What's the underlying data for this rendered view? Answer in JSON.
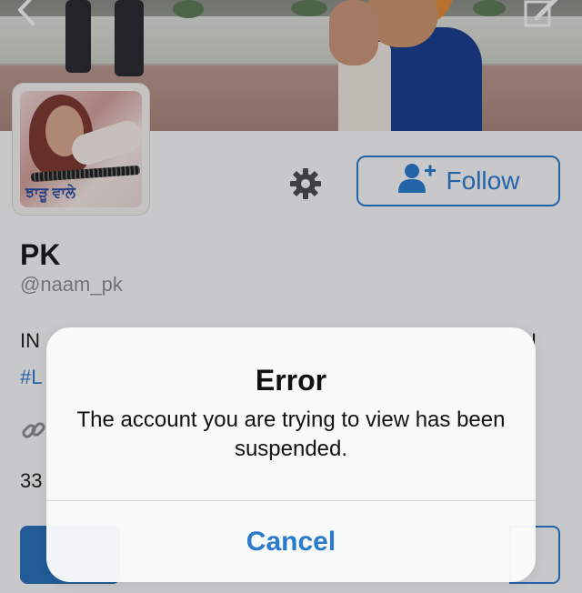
{
  "header": {
    "back_icon": "chevron-left-icon",
    "compose_icon": "compose-icon"
  },
  "profile": {
    "avatar_caption": "ਝਾੜੂ ਵਾਲੇ",
    "name": "PK",
    "handle": "@naam_pk",
    "bio_start": "IN",
    "bio_end": "I",
    "hashtag_start": "#L",
    "count_start": "33",
    "follow_label": "Follow"
  },
  "alert": {
    "title": "Error",
    "message": "The account you are trying to view has been suspended.",
    "cancel_label": "Cancel"
  },
  "colors": {
    "accent": "#2a7bcc",
    "text": "#111111",
    "secondary_text": "#8a8d91"
  }
}
